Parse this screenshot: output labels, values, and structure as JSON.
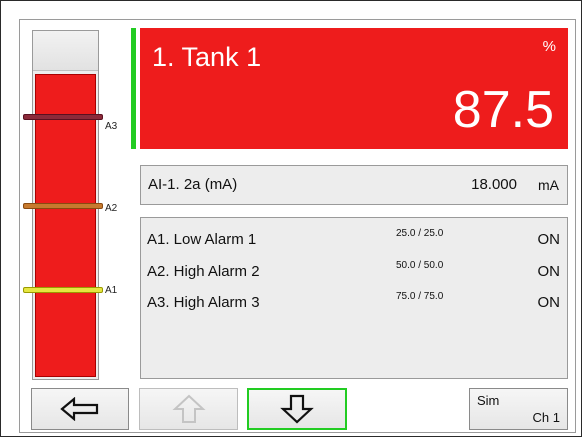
{
  "header": {
    "title": "1. Tank 1",
    "unit": "%",
    "value": "87.5",
    "background_color": "#ee1c1c",
    "accent_color": "#22cc22"
  },
  "level_bar": {
    "fill_percent": 87.5,
    "fill_color": "#ee1c1c",
    "markers": [
      {
        "label": "A3",
        "color": "#8c2a3a"
      },
      {
        "label": "A2",
        "color": "#c77a2e"
      },
      {
        "label": "A1",
        "color": "#e6e640"
      }
    ]
  },
  "analog_input": {
    "label": "AI-1. 2a (mA)",
    "value": "18.000",
    "unit": "mA"
  },
  "alarms": [
    {
      "name": "A1. Low Alarm 1",
      "setpoints": "25.0 / 25.0",
      "state": "ON"
    },
    {
      "name": "A2. High Alarm 2",
      "setpoints": "50.0 / 50.0",
      "state": "ON"
    },
    {
      "name": "A3. High Alarm 3",
      "setpoints": "75.0 / 75.0",
      "state": "ON"
    }
  ],
  "buttons": {
    "back": {
      "icon": "arrow-left-icon"
    },
    "up": {
      "icon": "arrow-up-icon",
      "enabled": false
    },
    "down": {
      "icon": "arrow-down-icon",
      "selected": true
    },
    "sim": {
      "label": "Sim",
      "channel": "Ch 1"
    }
  }
}
